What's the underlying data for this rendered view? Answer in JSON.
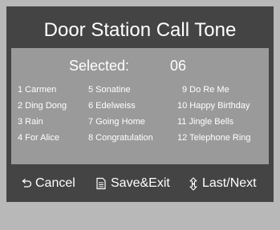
{
  "title": "Door Station Call Tone",
  "selected": {
    "label": "Selected:",
    "value": "06"
  },
  "tones": {
    "col1": [
      "1 Carmen",
      "2 Ding Dong",
      "3 Rain",
      "4 For Alice"
    ],
    "col2": [
      "5 Sonatine",
      "6 Edelweiss",
      "7 Going Home",
      "8 Congratulation"
    ],
    "col3": [
      "9 Do Re Me",
      "10 Happy Birthday",
      "11 Jingle Bells",
      "12 Telephone Ring"
    ]
  },
  "footer": {
    "cancel": "Cancel",
    "save": "Save&Exit",
    "nav": "Last/Next"
  },
  "icons": {
    "cancel": "return-arrow-icon",
    "save": "document-icon",
    "nav": "up-down-arrow-icon"
  }
}
